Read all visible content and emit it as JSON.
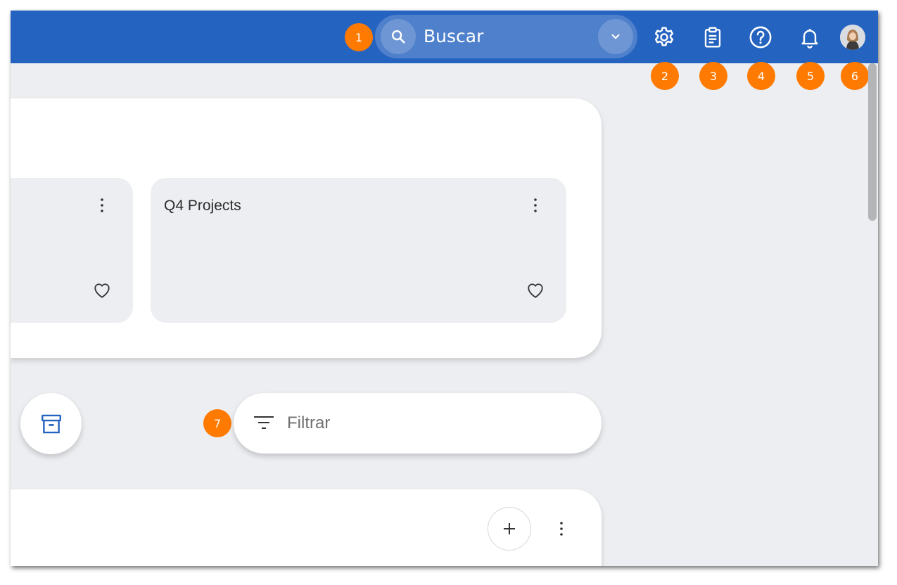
{
  "header": {
    "search_placeholder": "Buscar",
    "icons": [
      "search-icon",
      "chevron-down-icon",
      "gear-icon",
      "clipboard-icon",
      "help-icon",
      "bell-icon"
    ]
  },
  "badges": [
    "1",
    "2",
    "3",
    "4",
    "5",
    "6",
    "7"
  ],
  "boards": {
    "cards": [
      {
        "title": ""
      },
      {
        "title": "Q4 Projects"
      }
    ]
  },
  "filter": {
    "placeholder": "Filtrar"
  },
  "colors": {
    "topbar": "#2563c0",
    "badge": "#ff7a00",
    "background": "#eceef1",
    "accent_icon": "#2563c0"
  }
}
